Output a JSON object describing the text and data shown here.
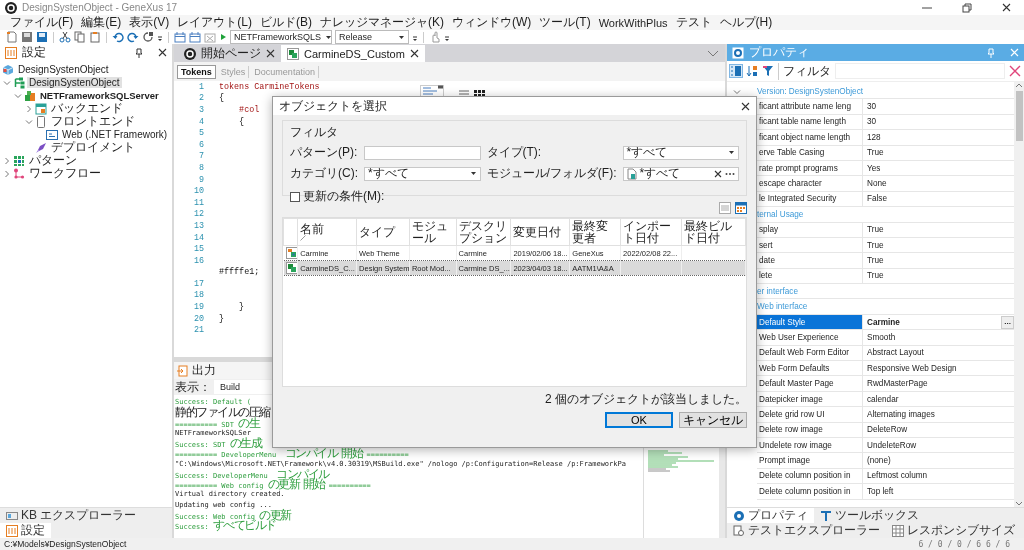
{
  "window": {
    "title": "DesignSystenObject - GeneXus 17"
  },
  "menu": [
    "ファイル(F)",
    "編集(E)",
    "表示(V)",
    "レイアウト(L)",
    "ビルド(B)",
    "ナレッジマネージャ(K)",
    "ウィンドウ(W)",
    "ツール(T)",
    "WorkWithPlus",
    "テスト",
    "ヘルプ(H)"
  ],
  "toolbar": {
    "platform": "NETFrameworkSQLS",
    "configuration": "Release"
  },
  "left_panel": {
    "title": "設定",
    "tree": [
      {
        "label": "DesignSystenObject",
        "kind": "kb",
        "selected": false,
        "active": false,
        "children": [
          {
            "label": "DesignSystenObject",
            "kind": "version",
            "expanded": true,
            "selected": true,
            "active": false,
            "children": [
              {
                "label": "NETFrameworkSQLServer",
                "kind": "environment",
                "expanded": true,
                "selected": false,
                "active": true,
                "children": [
                  {
                    "label": "バックエンド",
                    "kind": "backend",
                    "expanded": false,
                    "selected": false,
                    "active": false
                  },
                  {
                    "label": "フロントエンド",
                    "kind": "frontend",
                    "expanded": true,
                    "selected": false,
                    "active": false,
                    "children": [
                      {
                        "label": "Web (.NET Framework)",
                        "kind": "web",
                        "selected": false,
                        "active": false
                      }
                    ]
                  },
                  {
                    "label": "デプロイメント",
                    "kind": "deploy",
                    "selected": false,
                    "active": false
                  }
                ]
              }
            ]
          },
          {
            "label": "パターン",
            "kind": "patterns",
            "expanded": false,
            "selected": false,
            "active": false
          },
          {
            "label": "ワークフロー",
            "kind": "workflow",
            "expanded": false,
            "selected": false,
            "active": false
          }
        ]
      }
    ],
    "tabs": [
      {
        "label": "KB エクスプローラー",
        "kind": "kb_explorer",
        "selected": false
      },
      {
        "label": "設定",
        "kind": "preferences",
        "selected": true
      }
    ]
  },
  "document_tabs": [
    {
      "label": "開始ページ",
      "kind": "start",
      "selected": false
    },
    {
      "label": "CarmineDS_Custom",
      "kind": "design",
      "selected": true
    }
  ],
  "view_tabs": [
    {
      "label": "Tokens",
      "selected": true
    },
    {
      "label": "Styles",
      "selected": false
    },
    {
      "label": "Documentation",
      "selected": false
    }
  ],
  "editor": {
    "lines": [
      {
        "number": "1",
        "text": "tokens CarmineTokens",
        "kind": "keyword"
      },
      {
        "number": "2",
        "text": "{",
        "kind": "plain"
      },
      {
        "number": "3",
        "text": "    #col",
        "kind": "keyword"
      },
      {
        "number": "4",
        "text": "    {",
        "kind": "plain"
      },
      {
        "number": "5"
      },
      {
        "number": "6"
      },
      {
        "number": "7"
      },
      {
        "number": "8"
      },
      {
        "number": "9"
      },
      {
        "number": "10"
      },
      {
        "number": "11"
      },
      {
        "number": "12"
      },
      {
        "number": "13"
      },
      {
        "number": "14"
      },
      {
        "number": "15"
      },
      {
        "number": "16"
      },
      {
        "text": "#ffffe1;",
        "kind": "plain"
      },
      {
        "number": "17"
      },
      {
        "number": "18"
      },
      {
        "number": "19",
        "text": "    }",
        "kind": "plain"
      },
      {
        "number": "20",
        "text": "}",
        "kind": "plain"
      },
      {
        "number": "21"
      }
    ]
  },
  "output": {
    "title": "出力",
    "view_label": "表示：",
    "view": "Build",
    "lines": [
      {
        "text": "Success: Default (",
        "kind": "success"
      },
      {
        "text": "静的ファイルの圧縮",
        "kind": "plain"
      },
      {
        "text": "========== SDT の生",
        "kind": "success"
      },
      {
        "text": "NETFrameworkSQLSer",
        "kind": "plain"
      },
      {
        "text": "Success: SDT の生成",
        "kind": "success"
      },
      {
        "text": "========== DeveloperMenu  コンパイル 開始 ==========",
        "kind": "success"
      },
      {
        "text": "\"C:\\Windows\\Microsoft.NET\\Framework\\v4.0.30319\\MSBuild.exe\" /nologo /p:Configuration=Release /p:FrameworkPa",
        "kind": "plain"
      },
      {
        "text": "Success: DeveloperMenu  コンパイル",
        "kind": "success"
      },
      {
        "text": "========== Web config の更新 開始 ==========",
        "kind": "success"
      },
      {
        "text": "Virtual directory created.",
        "kind": "plain"
      },
      {
        "text": "Updating web config ...",
        "kind": "plain"
      },
      {
        "text": "Success: Web config の更新",
        "kind": "success"
      },
      {
        "text": "Success: すべてビルド",
        "kind": "success"
      }
    ]
  },
  "properties": {
    "title": "プロパティ",
    "filter_label": "フィルタ",
    "rows": [
      {
        "kind": "category",
        "label": "Version: DesignSystenObject",
        "expanded": true
      },
      {
        "kind": "property",
        "name": "ficant attribute name leng",
        "value": "30",
        "selected": false
      },
      {
        "kind": "property",
        "name": "ficant table name length",
        "value": "30",
        "selected": false
      },
      {
        "kind": "property",
        "name": "ficant object name length",
        "value": "128",
        "selected": false
      },
      {
        "kind": "property",
        "name": "erve Table Casing",
        "value": "True",
        "selected": false
      },
      {
        "kind": "property",
        "name": "rate prompt programs",
        "value": "Yes",
        "selected": false
      },
      {
        "kind": "property",
        "name": "escape character",
        "value": "None",
        "selected": false
      },
      {
        "kind": "property",
        "name": "le Integrated Security",
        "value": "False",
        "selected": false
      },
      {
        "kind": "category",
        "label": "ternal Usage"
      },
      {
        "kind": "property",
        "name": "splay",
        "value": "True",
        "selected": false
      },
      {
        "kind": "property",
        "name": "sert",
        "value": "True",
        "selected": false
      },
      {
        "kind": "property",
        "name": "date",
        "value": "True",
        "selected": false
      },
      {
        "kind": "property",
        "name": "lete",
        "value": "True",
        "selected": false
      },
      {
        "kind": "category",
        "label": "er interface"
      },
      {
        "kind": "category",
        "label": "Web interface"
      },
      {
        "kind": "property",
        "name": "Default Style",
        "value": "Carmine",
        "selected": true,
        "button": "..."
      },
      {
        "kind": "property",
        "name": "Web User Experience",
        "value": "Smooth",
        "selected": false
      },
      {
        "kind": "property",
        "name": "Default Web Form Editor",
        "value": "Abstract Layout",
        "selected": false
      },
      {
        "kind": "property",
        "name": "Web Form Defaults",
        "value": "Responsive Web Design",
        "selected": false
      },
      {
        "kind": "property",
        "name": "Default Master Page",
        "value": "RwdMasterPage",
        "selected": false
      },
      {
        "kind": "property",
        "name": "Datepicker image",
        "value": "calendar",
        "selected": false
      },
      {
        "kind": "property",
        "name": "Delete grid row UI",
        "value": "Alternating images",
        "selected": false
      },
      {
        "kind": "property",
        "name": "Delete row image",
        "value": "DeleteRow",
        "selected": false
      },
      {
        "kind": "property",
        "name": "Undelete row image",
        "value": "UndeleteRow",
        "selected": false
      },
      {
        "kind": "property",
        "name": "Prompt image",
        "value": "(none)",
        "selected": false
      },
      {
        "kind": "property",
        "name": "Delete column position in",
        "value": "Leftmost column",
        "selected": false
      },
      {
        "kind": "property",
        "name": "Delete column position in",
        "value": "Top left",
        "selected": false
      }
    ],
    "tabs": [
      {
        "label": "プロパティ",
        "kind": "properties",
        "selected": true
      },
      {
        "label": "ツールボックス",
        "kind": "toolbox",
        "selected": false
      },
      {
        "label": "テストエクスプローラー",
        "kind": "tests",
        "selected": false
      },
      {
        "label": "レスポンシブサイズ",
        "kind": "responsive",
        "selected": false
      }
    ]
  },
  "dialog": {
    "title": "オブジェクトを選択",
    "filter_legend": "フィルタ",
    "pattern": {
      "label": "パターン(P):"
    },
    "type": {
      "label": "タイプ(T):",
      "value": "*すべて"
    },
    "category": {
      "label": "カテゴリ(C):",
      "value": "*すべて"
    },
    "module": {
      "label": "モジュール/フォルダ(F):",
      "value": "*すべて"
    },
    "modified_condition": {
      "label": "更新の条件(M):",
      "checked": false
    },
    "columns": [
      {
        "label": "名前",
        "sorted": true
      },
      {
        "label": "タイプ",
        "sorted": false
      },
      {
        "label": "モジュール",
        "sorted": false
      },
      {
        "label": "デスクリプション",
        "sorted": false
      },
      {
        "label": "変更日付",
        "sorted": false
      },
      {
        "label": "最終変更者",
        "sorted": false
      },
      {
        "label": "インポート日付",
        "sorted": false
      },
      {
        "label": "最終ビルド日付",
        "sorted": false
      }
    ],
    "rows": [
      {
        "kind": "theme",
        "selected": false,
        "cells": [
          "Carmine",
          "Web Theme",
          null,
          "Carmine",
          "2019/02/06 18...",
          "GeneXus",
          "2022/02/08 22...",
          null
        ]
      },
      {
        "kind": "design_system",
        "selected": true,
        "cells": [
          "CarmineDS_C...",
          "Design System",
          "Root Mod...",
          "Carmine DS_...",
          "2023/04/03 18...",
          "AATM1\\A&A",
          null,
          null
        ]
      }
    ],
    "count": "2 個のオブジェクトが該当しました。",
    "buttons": [
      {
        "label": "OK",
        "default": true
      },
      {
        "label": "キャンセル",
        "default": false
      }
    ]
  },
  "status_bar": {
    "path": "C:¥Models¥DesignSystenObject",
    "counts": "6 / 0 / 0 / 6  6 / 6"
  }
}
